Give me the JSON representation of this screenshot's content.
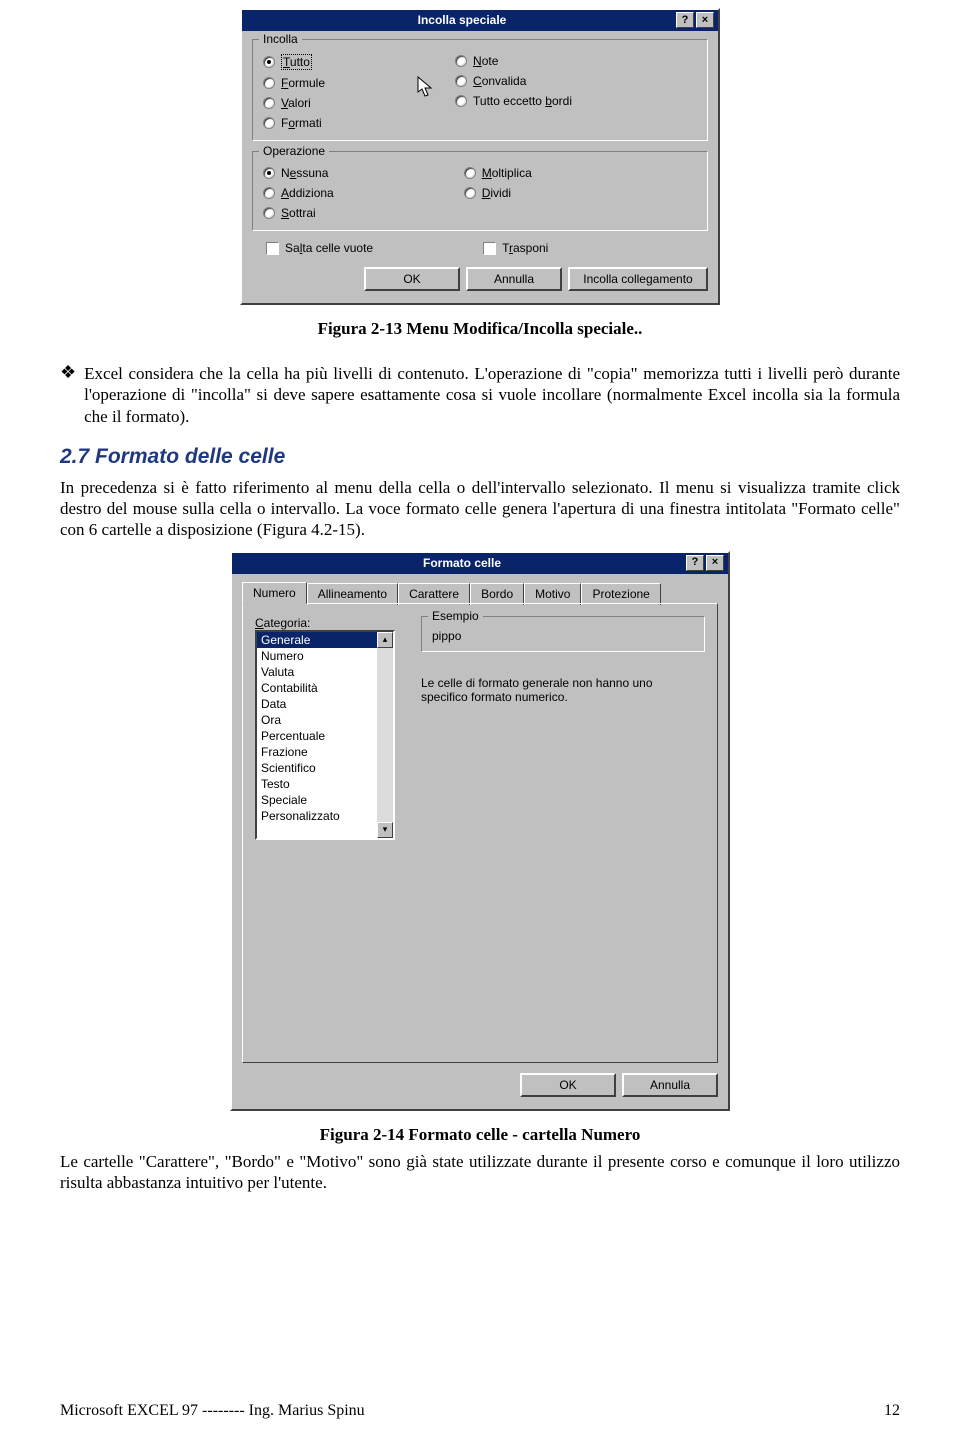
{
  "dialog1": {
    "title": "Incolla speciale",
    "group_incolla": "Incolla",
    "group_operazione": "Operazione",
    "radios_left1": [
      "Tutto",
      "Formule",
      "Valori",
      "Formati"
    ],
    "radios_right1": [
      "Note",
      "Convalida",
      "Tutto eccetto bordi"
    ],
    "radios_left2": [
      "Nessuna",
      "Addiziona",
      "Sottrai"
    ],
    "radios_right2": [
      "Moltiplica",
      "Dividi"
    ],
    "check_salta": "Salta celle vuote",
    "check_trasponi": "Trasponi",
    "btn_ok": "OK",
    "btn_cancel": "Annulla",
    "btn_link": "Incolla collegamento"
  },
  "caption1": "Figura 2-13 Menu Modifica/Incolla speciale..",
  "bullet_text": "Excel considera che la cella ha più livelli di contenuto. L'operazione di \"copia\" memorizza tutti i livelli però durante l'operazione di \"incolla\" si deve sapere esattamente cosa si vuole incollare (normalmente Excel incolla sia la formula che il formato).",
  "section": "2.7 Formato delle celle",
  "para1": "In precedenza si è fatto riferimento al menu della cella o dell'intervallo selezionato. Il menu si visualizza tramite click destro del mouse sulla cella o intervallo. La voce formato celle genera l'apertura di una finestra intitolata \"Formato celle\" con 6 cartelle a disposizione (Figura 4.2-15).",
  "dialog2": {
    "title": "Formato celle",
    "tabs": [
      "Numero",
      "Allineamento",
      "Carattere",
      "Bordo",
      "Motivo",
      "Protezione"
    ],
    "categoria_label": "Categoria:",
    "esempio_label": "Esempio",
    "esempio_value": "pippo",
    "desc": "Le celle di formato generale non hanno uno specifico formato numerico.",
    "categories": [
      "Generale",
      "Numero",
      "Valuta",
      "Contabilità",
      "Data",
      "Ora",
      "Percentuale",
      "Frazione",
      "Scientifico",
      "Testo",
      "Speciale",
      "Personalizzato"
    ],
    "btn_ok": "OK",
    "btn_cancel": "Annulla"
  },
  "caption2": "Figura 2-14 Formato celle - cartella Numero",
  "para2": "Le cartelle \"Carattere\", \"Bordo\" e \"Motivo\" sono già state utilizzate durante il presente corso e comunque il loro utilizzo risulta abbastanza intuitivo per l'utente.",
  "footer_left": "Microsoft EXCEL 97  --------   Ing. Marius Spinu",
  "footer_right": "12"
}
